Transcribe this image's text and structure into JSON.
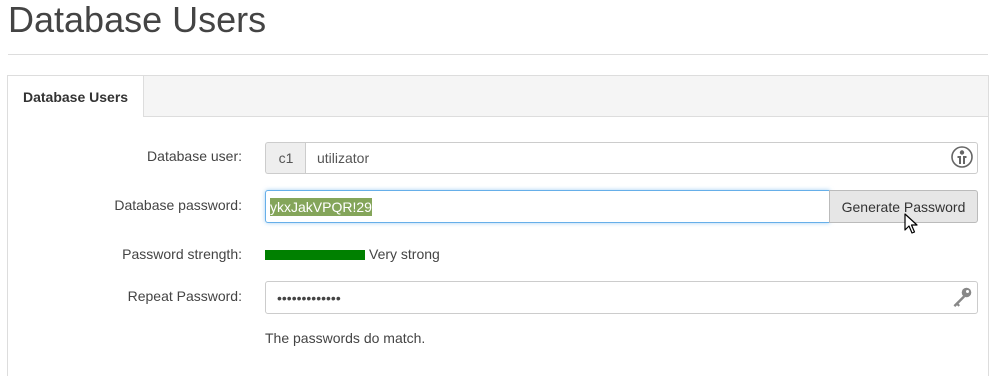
{
  "page": {
    "title": "Database Users"
  },
  "tabs": [
    {
      "label": "Database Users",
      "active": true
    }
  ],
  "form": {
    "user_label": "Database user:",
    "user_prefix": "c1",
    "user_value": "utilizator",
    "password_label": "Database password:",
    "password_value": "ykxJakVPQR!29",
    "generate_button": "Generate Password",
    "strength_label": "Password strength:",
    "strength_text": "Very strong",
    "strength_level": 1.0,
    "strength_color": "#008000",
    "repeat_label": "Repeat Password:",
    "repeat_value": "•••••••••••••",
    "match_message": "The passwords do match."
  },
  "icons": {
    "user_field_icon": "user-generate-icon",
    "repeat_field_icon": "key-icon",
    "pointer": "mouse-cursor-icon"
  },
  "colors": {
    "focus_border": "#66afe9",
    "selection": "#84a55a"
  }
}
